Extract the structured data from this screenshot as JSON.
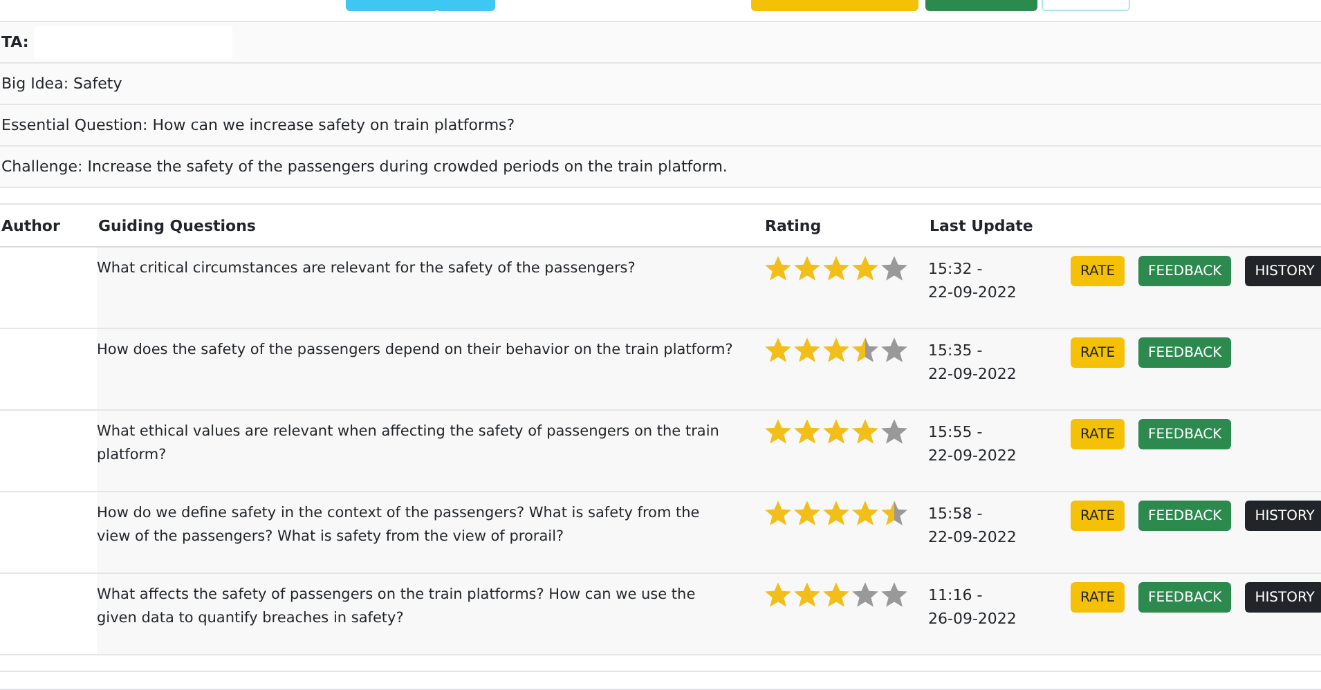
{
  "top_bar": {
    "buttons": [
      {
        "kind": "info"
      },
      {
        "kind": "info"
      },
      {
        "kind": "warning"
      },
      {
        "kind": "success"
      },
      {
        "kind": "outline"
      }
    ]
  },
  "info": [
    {
      "kind": "ta",
      "text": "TA:"
    },
    {
      "kind": "plain",
      "text": "Big Idea: Safety"
    },
    {
      "kind": "plain",
      "text": "Essential Question: How can we increase safety on train platforms?"
    },
    {
      "kind": "plain",
      "text": "Challenge: Increase the safety of the passengers during crowded periods on the train platform."
    }
  ],
  "table": {
    "columns": [
      "Author",
      "Guiding Questions",
      "Rating",
      "Last Update"
    ],
    "rows": [
      {
        "question": "What critical circumstances are relevant for the safety of the passengers?",
        "stars": 4,
        "time": "15:32 -",
        "date": "22-09-2022",
        "buttons": [
          {
            "kind": "rate",
            "label": "RATE"
          },
          {
            "kind": "feedback",
            "label": "FEEDBACK"
          },
          {
            "kind": "history",
            "label": "HISTORY"
          }
        ]
      },
      {
        "question": "How does the safety of the passengers depend on their behavior on the train platform?",
        "stars": 3.5,
        "time": "15:35 -",
        "date": "22-09-2022",
        "buttons": [
          {
            "kind": "rate",
            "label": "RATE"
          },
          {
            "kind": "feedback",
            "label": "FEEDBACK"
          }
        ]
      },
      {
        "question": "What ethical values are relevant when affecting the safety of passengers on the train platform?",
        "stars": 4,
        "time": "15:55 -",
        "date": "22-09-2022",
        "buttons": [
          {
            "kind": "rate",
            "label": "RATE"
          },
          {
            "kind": "feedback",
            "label": "FEEDBACK"
          }
        ]
      },
      {
        "question": "How do we define safety in the context of the passengers? What is safety from the view of the passengers? What is safety from the view of prorail?",
        "stars": 4.5,
        "time": "15:58 -",
        "date": "22-09-2022",
        "buttons": [
          {
            "kind": "rate",
            "label": "RATE"
          },
          {
            "kind": "feedback",
            "label": "FEEDBACK"
          },
          {
            "kind": "history",
            "label": "HISTORY"
          }
        ]
      },
      {
        "question": "What affects the safety of passengers on the train platforms? How can we use the given data to quantify breaches in safety?",
        "stars": 3,
        "time": "11:16 -",
        "date": "26-09-2022",
        "buttons": [
          {
            "kind": "rate",
            "label": "RATE"
          },
          {
            "kind": "feedback",
            "label": "FEEDBACK"
          },
          {
            "kind": "history",
            "label": "HISTORY"
          }
        ]
      }
    ]
  }
}
